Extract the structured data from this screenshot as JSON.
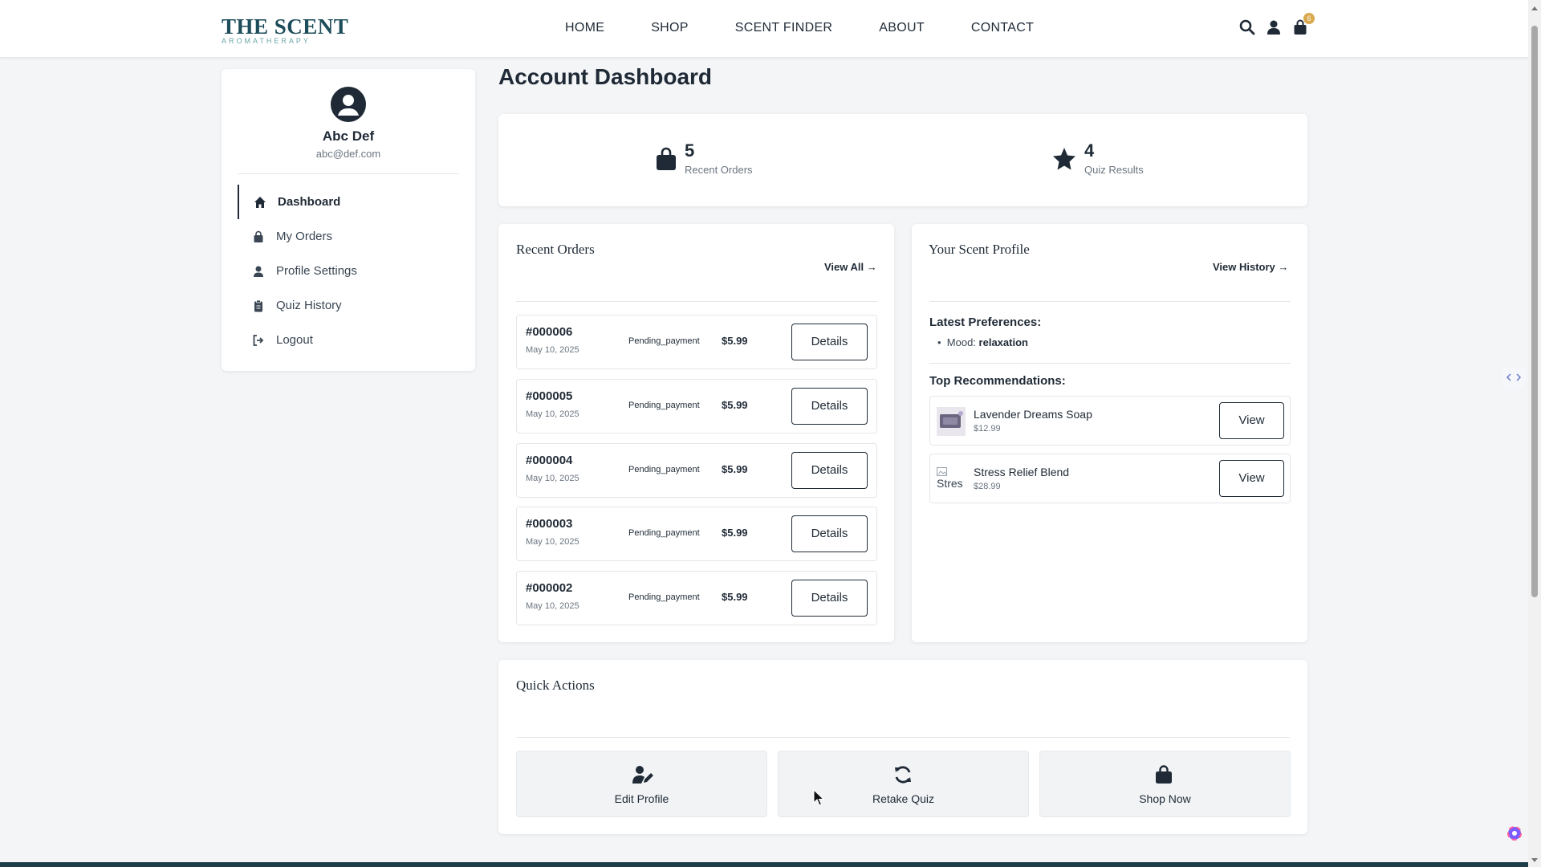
{
  "brand": {
    "name": "THE SCENT",
    "tagline": "AROMATHERAPY",
    "accent": "#1d4d5a",
    "badge_color": "#d9a94e"
  },
  "nav": [
    "HOME",
    "SHOP",
    "SCENT FINDER",
    "ABOUT",
    "CONTACT"
  ],
  "header_icons": {
    "search": "search-icon",
    "account": "user-icon",
    "cart": "shopping-bag-icon",
    "cart_count": "6"
  },
  "user": {
    "name": "Abc Def",
    "email": "abc@def.com"
  },
  "sidebar": {
    "items": [
      {
        "label": "Dashboard",
        "icon": "home-icon",
        "active": true
      },
      {
        "label": "My Orders",
        "icon": "shopping-bag-icon"
      },
      {
        "label": "Profile Settings",
        "icon": "user-icon"
      },
      {
        "label": "Quiz History",
        "icon": "clipboard-icon"
      },
      {
        "label": "Logout",
        "icon": "sign-out-icon"
      }
    ]
  },
  "page": {
    "title": "Account Dashboard"
  },
  "stats": [
    {
      "value": "5",
      "label": "Recent Orders",
      "icon": "shopping-bag-icon"
    },
    {
      "value": "4",
      "label": "Quiz Results",
      "icon": "star-icon"
    }
  ],
  "orders": {
    "title": "Recent Orders",
    "link": "View All →",
    "button_label": "Details",
    "rows": [
      {
        "id": "#000006",
        "date": "May 10, 2025",
        "status": "Pending_payment",
        "total": "$5.99"
      },
      {
        "id": "#000005",
        "date": "May 10, 2025",
        "status": "Pending_payment",
        "total": "$5.99"
      },
      {
        "id": "#000004",
        "date": "May 10, 2025",
        "status": "Pending_payment",
        "total": "$5.99"
      },
      {
        "id": "#000003",
        "date": "May 10, 2025",
        "status": "Pending_payment",
        "total": "$5.99"
      },
      {
        "id": "#000002",
        "date": "May 10, 2025",
        "status": "Pending_payment",
        "total": "$5.99"
      }
    ]
  },
  "profile": {
    "title": "Your Scent Profile",
    "link": "View History →",
    "preferences_heading": "Latest Preferences:",
    "preferences": [
      {
        "key": "Mood:",
        "value": "relaxation"
      }
    ],
    "recommendations_heading": "Top Recommendations:",
    "button_label": "View",
    "recommendations": [
      {
        "name": "Lavender Dreams Soap",
        "price": "$12.99",
        "thumb_alt": ""
      },
      {
        "name": "Stress Relief Blend",
        "price": "$28.99",
        "thumb_alt": "Stres"
      }
    ]
  },
  "quick_actions": {
    "title": "Quick Actions",
    "items": [
      {
        "label": "Edit Profile",
        "icon": "user-edit-icon"
      },
      {
        "label": "Retake Quiz",
        "icon": "refresh-icon"
      },
      {
        "label": "Shop Now",
        "icon": "shopping-bag-icon"
      }
    ]
  }
}
